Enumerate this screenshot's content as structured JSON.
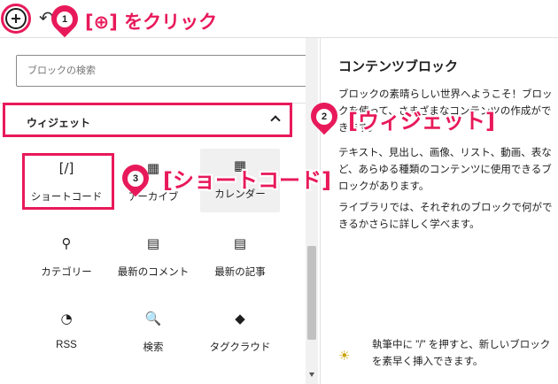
{
  "accent_color": "#e8195a",
  "toolbar": {
    "add_button_icon": "plus-circle-icon",
    "undo_icon": "undo-icon"
  },
  "search": {
    "placeholder": "ブロックの検索"
  },
  "widgets_section": {
    "title": "ウィジェット",
    "expanded": true,
    "blocks": [
      {
        "icon": "shortcode-icon",
        "glyph": "[/]",
        "label": "ショートコード",
        "selected": true
      },
      {
        "icon": "archive-calendar-icon",
        "glyph": "▦",
        "label": "アーカイブ",
        "selected": false
      },
      {
        "icon": "calendar-icon",
        "glyph": "▦",
        "label": "カレンダー",
        "selected": false
      },
      {
        "icon": "categories-icon",
        "glyph": "⚲",
        "label": "カテゴリー",
        "selected": false
      },
      {
        "icon": "comment-icon",
        "glyph": "▤",
        "label": "最新のコメント",
        "selected": false
      },
      {
        "icon": "posts-list-icon",
        "glyph": "▤",
        "label": "最新の記事",
        "selected": false
      },
      {
        "icon": "rss-icon",
        "glyph": "◔",
        "label": "RSS",
        "selected": false
      },
      {
        "icon": "search-icon",
        "glyph": "🔍",
        "label": "検索",
        "selected": false
      },
      {
        "icon": "tag-icon",
        "glyph": "◆",
        "label": "タグクラウド",
        "selected": false
      }
    ]
  },
  "preview": {
    "title": "コンテンツブロック",
    "paragraphs": [
      "ブロックの素晴らしい世界へようこそ！ブロックを使って、さまざまなコンテンツの作成ができます。",
      "テキスト、見出し、画像、リスト、動画、表など、あらゆる種類のコンテンツに使用できるブロックがあります。",
      "ライブラリでは、それぞれのブロックで何ができるかさらに詳しく学べます。"
    ],
    "tip_icon": "lightbulb-icon",
    "tip": "執筆中に \"/\" を押すと、新しいブロックを素早く挿入できます。"
  },
  "annotations": [
    {
      "number": "1",
      "text": "[⊕] をクリック"
    },
    {
      "number": "2",
      "text": "[ウィジェット]"
    },
    {
      "number": "3",
      "text": "[ショートコード]"
    }
  ]
}
